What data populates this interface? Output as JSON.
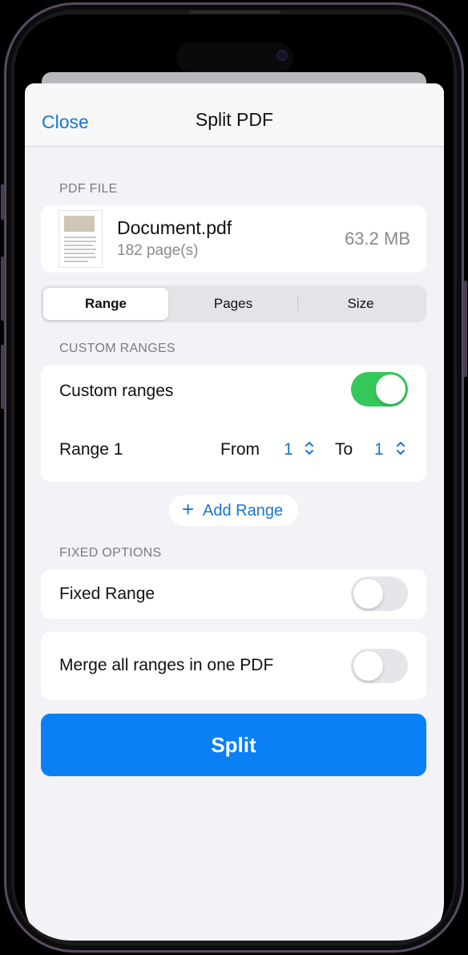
{
  "nav": {
    "close_label": "Close",
    "title": "Split PDF"
  },
  "pdf_section": {
    "header": "PDF FILE",
    "file_name": "Document.pdf",
    "pages": "182 page(s)",
    "size": "63.2 MB"
  },
  "tabs": [
    {
      "label": "Range",
      "active": true
    },
    {
      "label": "Pages",
      "active": false
    },
    {
      "label": "Size",
      "active": false
    }
  ],
  "custom_ranges": {
    "header": "CUSTOM RANGES",
    "toggle_label": "Custom ranges",
    "toggle_on": true,
    "range": {
      "label": "Range 1",
      "from_label": "From",
      "from_value": "1",
      "to_label": "To",
      "to_value": "1"
    },
    "add_range_label": "Add Range"
  },
  "fixed_options": {
    "header": "FIXED OPTIONS",
    "fixed_range_label": "Fixed Range",
    "fixed_range_on": false,
    "merge_label": "Merge all ranges in one PDF",
    "merge_on": false
  },
  "split_button_label": "Split",
  "colors": {
    "accent": "#1577d6",
    "primary_button": "#0a7ff6",
    "toggle_on": "#34c759"
  },
  "icons": {
    "add": "plus-icon",
    "stepper": "chevron-up-down-icon"
  }
}
